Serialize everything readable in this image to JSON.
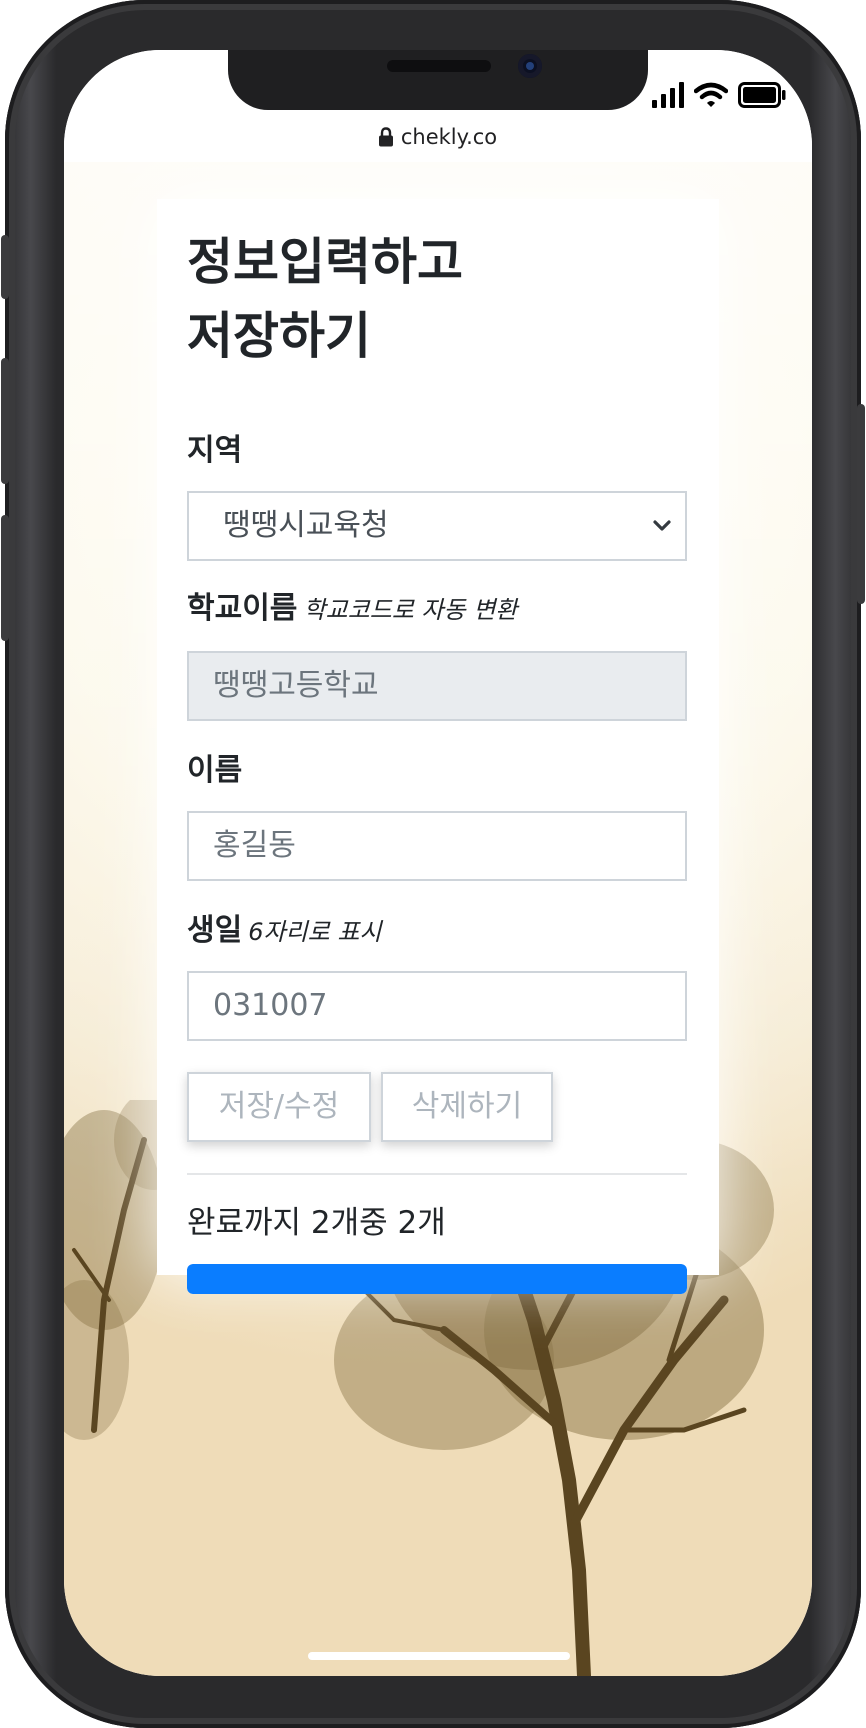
{
  "browser": {
    "url": "chekly.co"
  },
  "form": {
    "title_line1": "정보입력하고",
    "title_line2": "저장하기",
    "region": {
      "label": "지역",
      "selected": "땡땡시교육청"
    },
    "school": {
      "label": "학교이름",
      "hint": "학교코드로 자동 변환",
      "value": "땡땡고등학교"
    },
    "name": {
      "label": "이름",
      "placeholder": "홍길동"
    },
    "birthday": {
      "label": "생일",
      "hint": "6자리로 표시",
      "placeholder": "031007"
    },
    "buttons": {
      "save": "저장/수정",
      "delete": "삭제하기"
    },
    "progress": {
      "text": "완료까지 2개중 2개",
      "completed": 2,
      "total": 2,
      "fraction": 1.0
    }
  },
  "colors": {
    "accent": "#0a7dff",
    "text": "#212529",
    "border": "#ced4da",
    "disabled_bg": "#e9ecef"
  },
  "icons": {
    "lock": "lock-icon",
    "select": "chevron-down-icon",
    "signal": "cellular-signal-icon",
    "wifi": "wifi-icon",
    "battery": "battery-icon"
  }
}
